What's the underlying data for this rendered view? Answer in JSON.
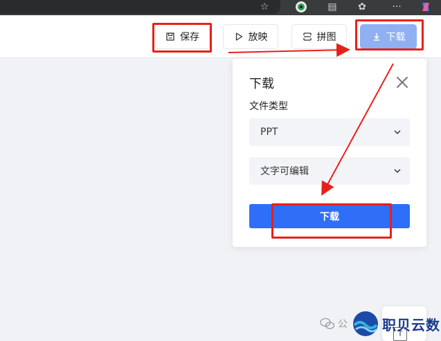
{
  "toolbar": {
    "save_label": "保存",
    "play_label": "放映",
    "collage_label": "拼图",
    "download_label": "下载"
  },
  "download_panel": {
    "title": "下载",
    "file_type_label": "文件类型",
    "file_type_value": "PPT",
    "mode_value": "文字可编辑",
    "download_button_label": "下载"
  },
  "watermark": {
    "prefix": "公",
    "brand": "职贝云数"
  },
  "side_widget": {
    "glyph": "T"
  },
  "colors": {
    "primary": "#2f6ef6",
    "primary_light": "#8fb1f2",
    "annotation_red": "#e8201a"
  }
}
